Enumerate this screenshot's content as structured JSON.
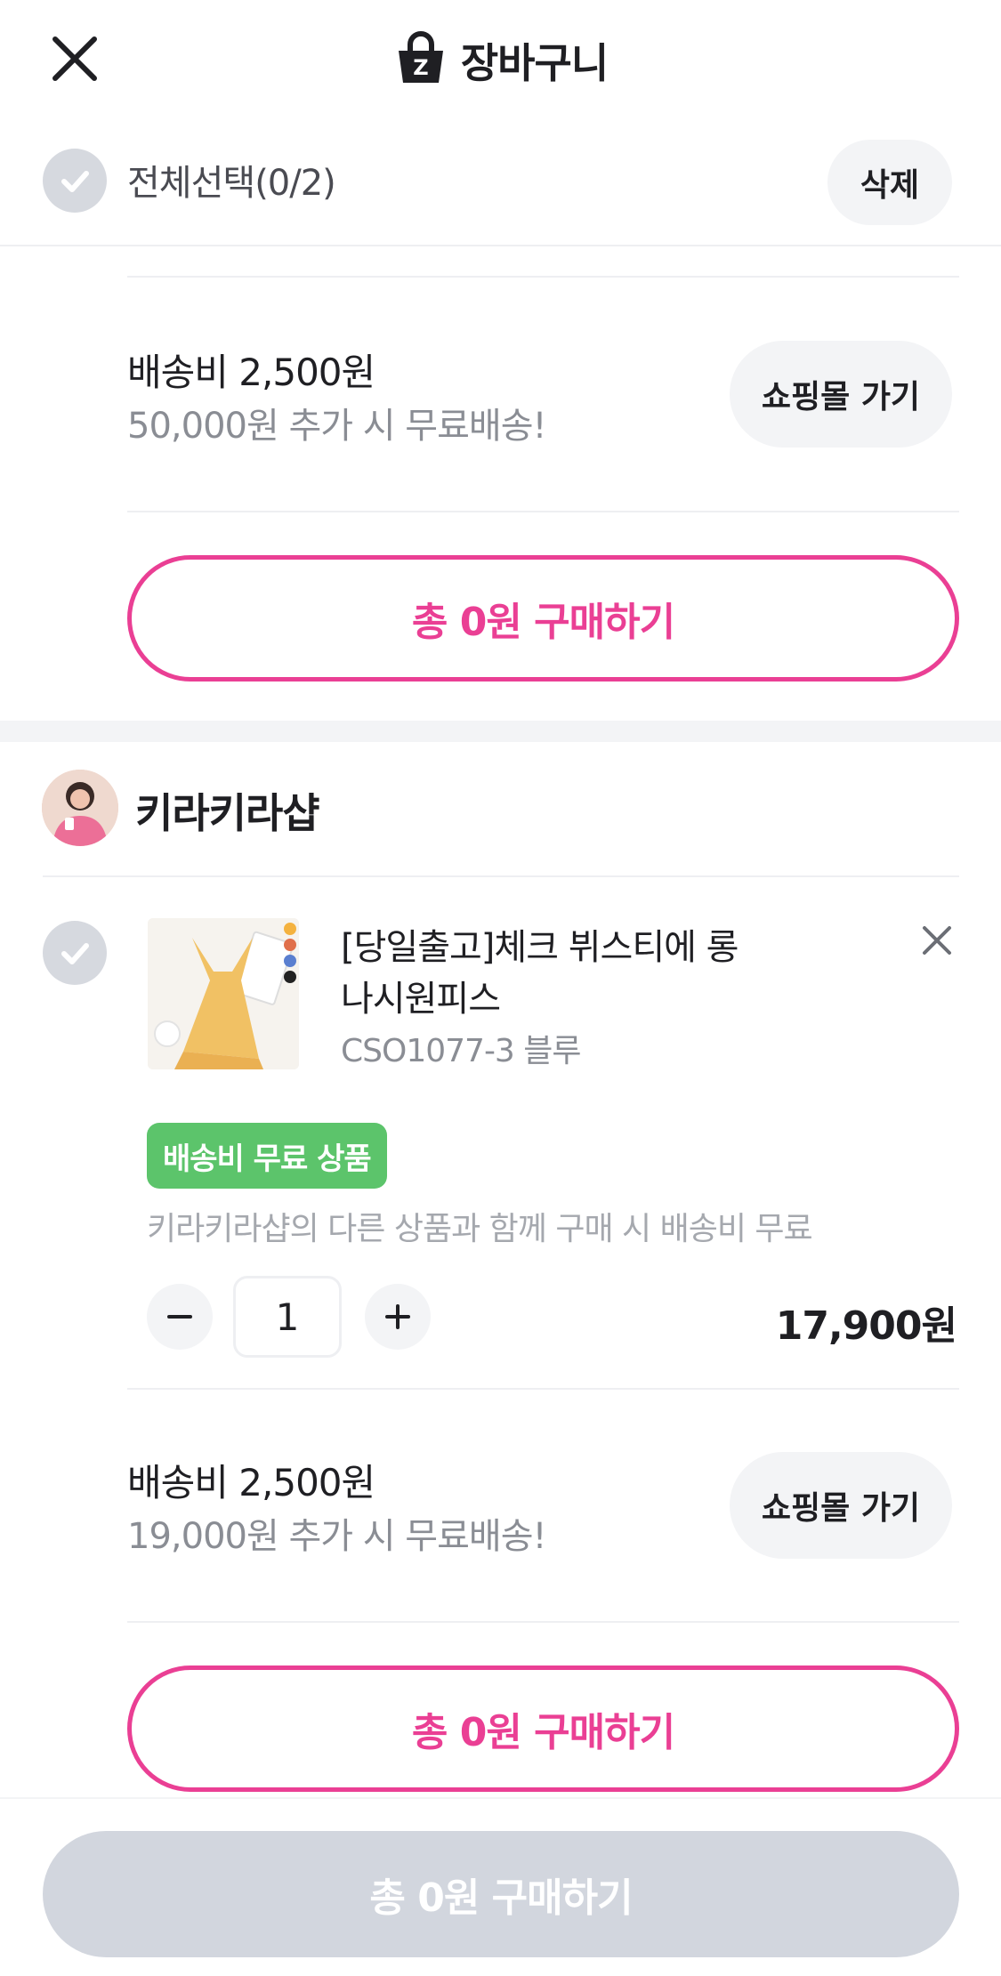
{
  "header": {
    "title": "장바구니",
    "icon": "shopping-bag-icon",
    "close_icon": "close-icon"
  },
  "select_all": {
    "label": "전체선택(0/2)",
    "delete_label": "삭제"
  },
  "first_shop": {
    "shipping_fee": "배송비 2,500원",
    "free_shipping_hint": "50,000원 추가 시 무료배송!",
    "mall_button": "쇼핑몰 가기",
    "buy_button": "총 0원 구매하기"
  },
  "second_shop": {
    "name": "키라키라샵",
    "product": {
      "name": "[당일출고]체크 뷔스티에 롱 나시원피스",
      "option": "CSO1077-3 블루",
      "badge": "배송비 무료 상품",
      "badge_note": "키라키라샵의 다른 상품과 함께 구매 시 배송비 무료",
      "quantity": "1",
      "price": "17,900원"
    },
    "shipping_fee": "배송비 2,500원",
    "free_shipping_hint": "19,000원 추가 시 무료배송!",
    "mall_button": "쇼핑몰 가기",
    "buy_button": "총 0원 구매하기"
  },
  "bottom": {
    "buy_button": "총 0원 구매하기"
  },
  "colors": {
    "accent": "#ea3f94",
    "badge_green": "#5cc46b",
    "disabled": "#d2d6de"
  }
}
